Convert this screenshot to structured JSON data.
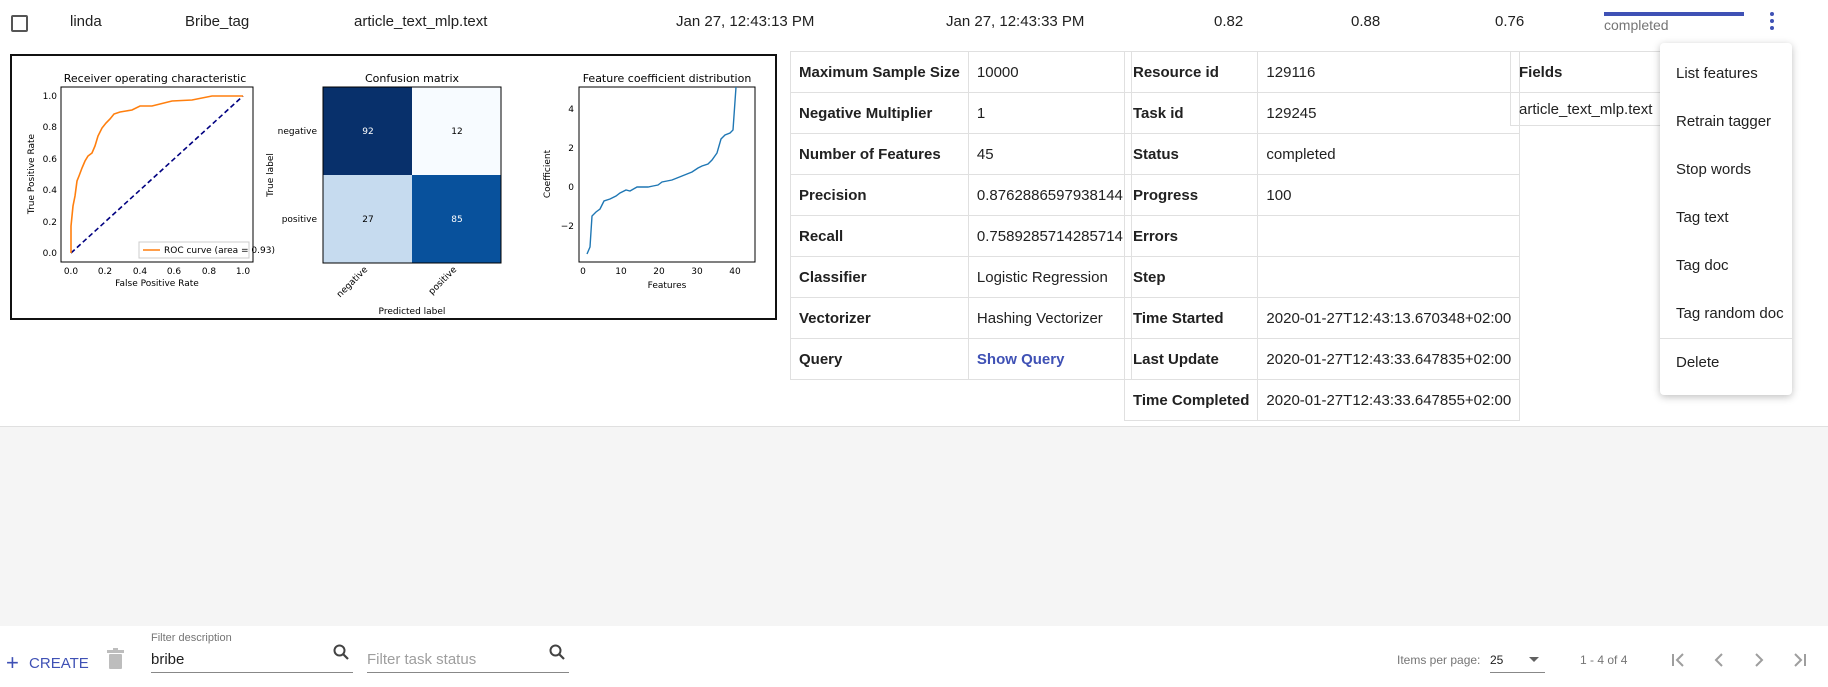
{
  "row": {
    "author": "linda",
    "description": "Bribe_tag",
    "fields": "article_text_mlp.text",
    "time_started": "Jan 27, 12:43:13 PM",
    "time_completed": "Jan 27, 12:43:33 PM",
    "f1": "0.82",
    "precision": "0.88",
    "recall": "0.76",
    "status": "completed",
    "progress": 100
  },
  "plots": {
    "roc": {
      "title": "Receiver operating characteristic",
      "xlabel": "False Positive Rate",
      "ylabel": "True Positive Rate",
      "legend": "ROC curve (area = 0.93)",
      "xticks": [
        "0.0",
        "0.2",
        "0.4",
        "0.6",
        "0.8",
        "1.0"
      ],
      "yticks": [
        "0.0",
        "0.2",
        "0.4",
        "0.6",
        "0.8",
        "1.0"
      ]
    },
    "confusion": {
      "title": "Confusion matrix",
      "xlabel": "Predicted label",
      "ylabel": "True label",
      "labels": [
        "negative",
        "positive"
      ],
      "values": [
        [
          "92",
          "12"
        ],
        [
          "27",
          "85"
        ]
      ]
    },
    "coef": {
      "title": "Feature coefficient distribution",
      "xlabel": "Features",
      "ylabel": "Coefficient",
      "xticks": [
        "0",
        "10",
        "20",
        "30",
        "40"
      ],
      "yticks": [
        "4",
        "2",
        "0",
        "−2"
      ]
    }
  },
  "params": [
    {
      "k": "Maximum Sample Size",
      "v": "10000"
    },
    {
      "k": "Negative Multiplier",
      "v": "1"
    },
    {
      "k": "Number of Features",
      "v": "45"
    },
    {
      "k": "Precision",
      "v": "0.8762886597938144"
    },
    {
      "k": "Recall",
      "v": "0.7589285714285714"
    },
    {
      "k": "Classifier",
      "v": "Logistic Regression"
    },
    {
      "k": "Vectorizer",
      "v": "Hashing Vectorizer"
    },
    {
      "k": "Query",
      "v": "Show Query"
    }
  ],
  "task": [
    {
      "k": "Resource id",
      "v": "129116"
    },
    {
      "k": "Task id",
      "v": "129245"
    },
    {
      "k": "Status",
      "v": "completed"
    },
    {
      "k": "Progress",
      "v": "100"
    },
    {
      "k": "Errors",
      "v": ""
    },
    {
      "k": "Step",
      "v": ""
    },
    {
      "k": "Time Started",
      "v": "2020-01-27T12:43:13.670348+02:00"
    },
    {
      "k": "Last Update",
      "v": "2020-01-27T12:43:33.647835+02:00"
    },
    {
      "k": "Time Completed",
      "v": "2020-01-27T12:43:33.647855+02:00"
    }
  ],
  "fields_table": {
    "header": "Fields",
    "value": "article_text_mlp.text"
  },
  "menu": [
    "List features",
    "Retrain tagger",
    "Stop words",
    "Tag text",
    "Tag doc",
    "Tag random doc",
    "Delete"
  ],
  "footer": {
    "create": "CREATE",
    "filter_desc_label": "Filter description",
    "filter_desc_value": "bribe",
    "filter_status_placeholder": "Filter task status",
    "items_per_page_label": "Items per page:",
    "items_per_page": "25",
    "range": "1 - 4 of 4"
  },
  "colors": {
    "accent": "#3f51b5",
    "roc": "#ff7f0e",
    "coef": "#1f77b4"
  }
}
